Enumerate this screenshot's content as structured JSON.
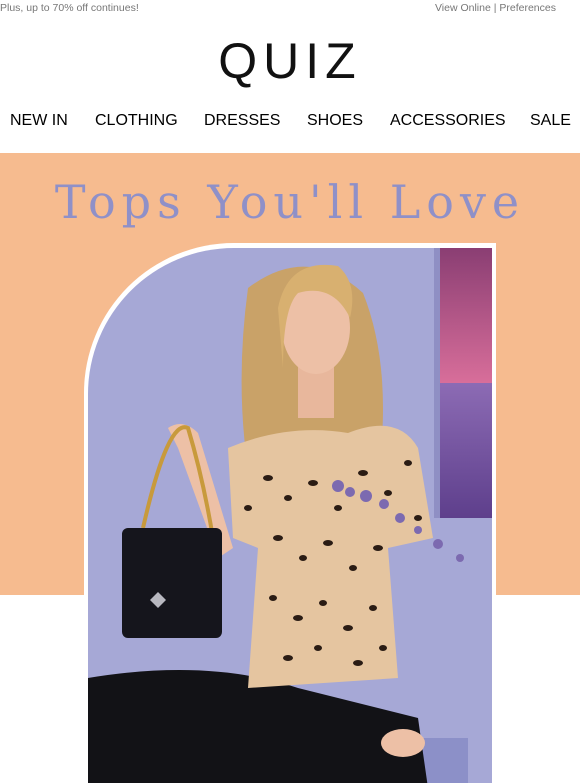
{
  "preheader": {
    "text": "Plus, up to 70% off continues!",
    "view_online": "View Online",
    "separator": "|",
    "preferences": "Preferences"
  },
  "brand": {
    "logo": "QUIZ"
  },
  "nav": {
    "items": [
      "NEW IN",
      "CLOTHING",
      "DRESSES",
      "SHOES",
      "ACCESSORIES",
      "SALE"
    ]
  },
  "hero": {
    "headline": "Tops You'll Love",
    "background_color": "#f6bb8f",
    "headline_color": "#8f90c8"
  }
}
